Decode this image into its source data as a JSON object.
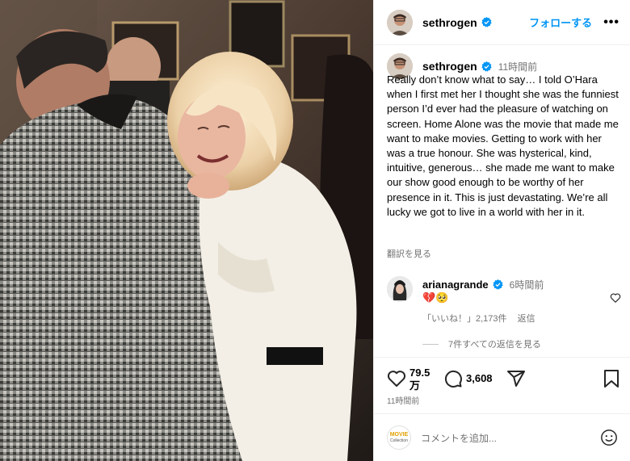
{
  "header": {
    "username": "sethrogen",
    "follow_label": "フォローする",
    "more_label": "•••"
  },
  "caption": {
    "username": "sethrogen",
    "time": "11時間前",
    "text": "Really don’t know what to say… I told O’Hara when I first met her I thought she was the funniest person I’d ever had the pleasure of watching on screen. Home Alone was the movie that made me want to make movies. Getting to work with her was a true honour. She was hysterical, kind, intuitive, generous… she made me want to make our show good enough to be worthy of her presence in it. This is just devastating. We’re all lucky we got to live in a world with her in it.",
    "translate_label": "翻訳を見る"
  },
  "comment": {
    "username": "arianagrande",
    "time": "6時間前",
    "text": "💔🥺",
    "likes_label": "「いいね！」2,173件",
    "reply_label": "返信",
    "view_replies_label": "7件すべての返信を見る"
  },
  "actions": {
    "likes_count": "79.5",
    "likes_unit": "万",
    "comments_count": "3,608",
    "posted_ago": "11時間前"
  },
  "add_comment": {
    "placeholder": "コメントを追加...",
    "logo_top": "MOVIE",
    "logo_bottom": "Collection"
  },
  "colors": {
    "link_blue": "#0095f6",
    "verified_blue": "#0095f6",
    "muted_gray": "#737373"
  },
  "icons": [
    "verified-badge-icon",
    "more-icon",
    "heart-icon",
    "comment-icon",
    "share-icon",
    "bookmark-icon",
    "emoji-icon"
  ]
}
